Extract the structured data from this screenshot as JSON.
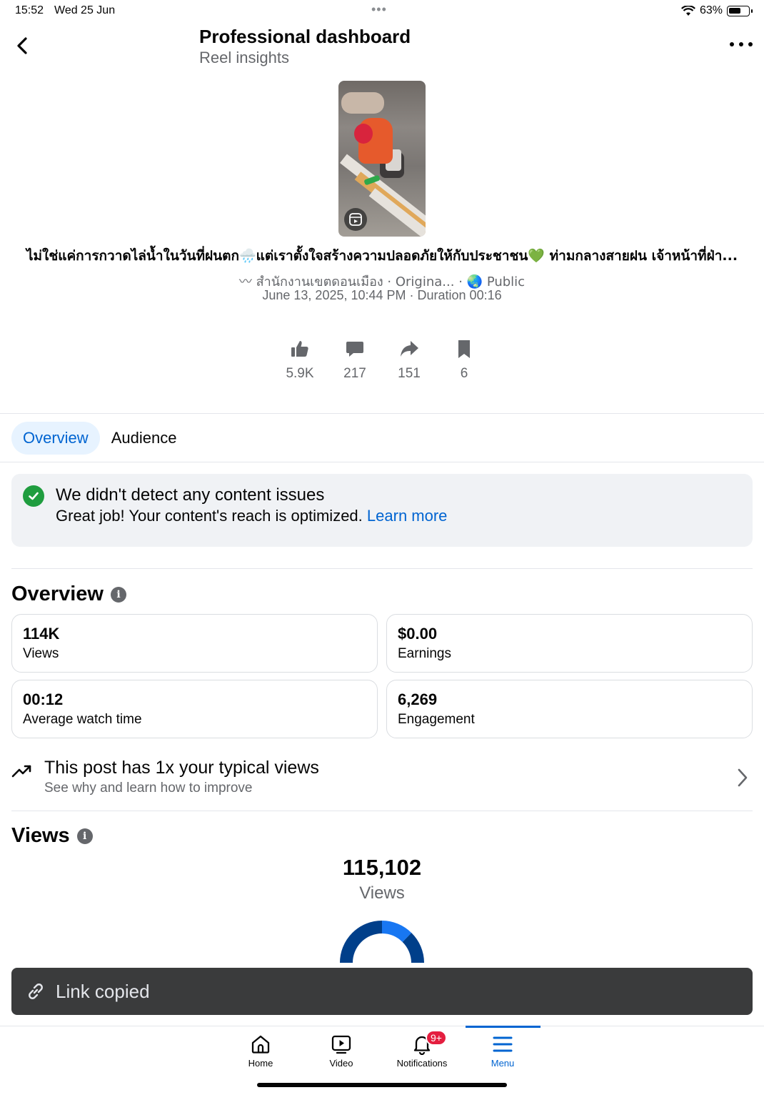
{
  "status": {
    "time": "15:52",
    "date": "Wed 25 Jun",
    "battery": "63%",
    "battery_level": 0.63
  },
  "header": {
    "title": "Professional dashboard",
    "subtitle": "Reel insights"
  },
  "post": {
    "caption": "ไม่ใช่แค่การกวาดไล่น้ำในวันที่ฝนตก🌧️แต่เราตั้งใจสร้างความปลอดภัยให้กับประชาชน💚 ท่ามกลางสายฝน เจ้าหน้าที่ฝ่า...",
    "audio": "สำนักงานเขตดอนเมือง · Origina...",
    "visibility": "Public",
    "date_duration": "June 13, 2025, 10:44 PM · Duration 00:16"
  },
  "stats": {
    "likes": "5.9K",
    "comments": "217",
    "shares": "151",
    "saves": "6"
  },
  "tabs": {
    "overview": "Overview",
    "audience": "Audience"
  },
  "issues": {
    "title": "We didn't detect any content issues",
    "text": "Great job! Your content's reach is optimized.",
    "link": "Learn more"
  },
  "overview": {
    "title": "Overview",
    "metrics": [
      {
        "value": "114K",
        "label": "Views"
      },
      {
        "value": "$0.00",
        "label": "Earnings"
      },
      {
        "value": "00:12",
        "label": "Average watch time"
      },
      {
        "value": "6,269",
        "label": "Engagement"
      }
    ]
  },
  "typical": {
    "title": "This post has 1x your typical views",
    "subtitle": "See why and learn how to improve"
  },
  "views": {
    "title": "Views",
    "total": "115,102",
    "label": "Views"
  },
  "toast": {
    "text": "Link copied"
  },
  "tabbar": {
    "home": "Home",
    "video": "Video",
    "notifications": "Notifications",
    "notifications_badge": "9+",
    "menu": "Menu"
  },
  "colors": {
    "accent": "#0064d1",
    "success": "#1f9d3f",
    "badge": "#e41e3f",
    "donut_dark": "#003f8a",
    "donut_light": "#1877f2"
  }
}
